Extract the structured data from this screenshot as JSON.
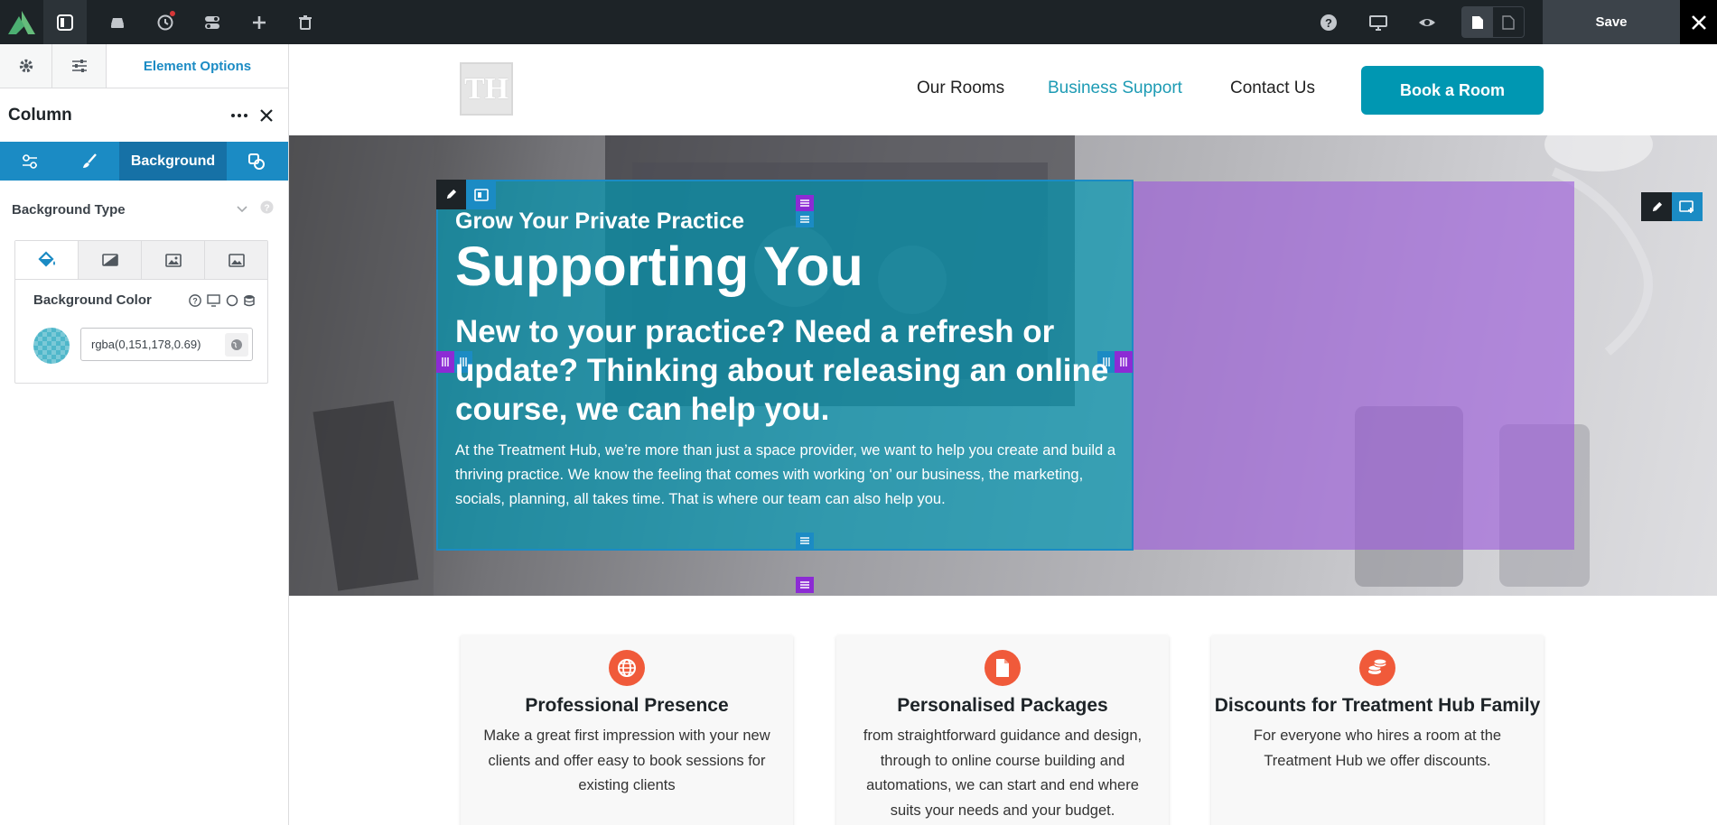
{
  "toolbar": {
    "save_label": "Save",
    "icons": [
      "avada-logo-icon",
      "sidebar-toggle-icon",
      "library-icon",
      "history-icon",
      "toggles-icon",
      "add-icon",
      "trash-icon",
      "help-icon",
      "desktop-preview-icon",
      "eye-preview-icon",
      "page-icon",
      "page-blank-icon",
      "close-icon"
    ]
  },
  "sidebar": {
    "tab_label": "Element Options",
    "panel_title": "Column",
    "subtab_active": "Background",
    "bg_type_label": "Background Type",
    "bg_color_label": "Background Color",
    "bg_color_value": "rgba(0,151,178,0.69)"
  },
  "site": {
    "logo_text": "TH",
    "nav": [
      "Our Rooms",
      "Business Support",
      "Contact Us"
    ],
    "cta": "Book a Room"
  },
  "hero": {
    "subtitle": "Grow Your Private Practice",
    "title": "Supporting You",
    "lead": "New to your practice? Need a refresh or update? Thinking about releasing an online course, we can help you.",
    "body": "At the Treatment Hub, we’re more than just a space provider, we want to help you create and build a thriving practice. We know the feeling that comes with working ‘on’ our business, the marketing, socials, planning, all takes time. That is where our team can also help you."
  },
  "features": [
    {
      "title": "Professional Presence",
      "text": "Make a great first impression with your new clients and offer easy to book sessions for existing clients",
      "icon": "globe-icon"
    },
    {
      "title": "Personalised Packages",
      "text": "from straightforward guidance and design, through to online course building and automations, we can start and end where suits your needs and your budget.",
      "icon": "document-icon"
    },
    {
      "title": "Discounts for Treatment Hub Family",
      "text": "For everyone who hires a room at the Treatment Hub we offer discounts.",
      "icon": "coins-icon"
    }
  ],
  "colors": {
    "accent": "#1b8bc4",
    "brand": "#0097b2",
    "feature_icon": "#f05a3a",
    "column_overlay_purple": "#9b59dc"
  }
}
